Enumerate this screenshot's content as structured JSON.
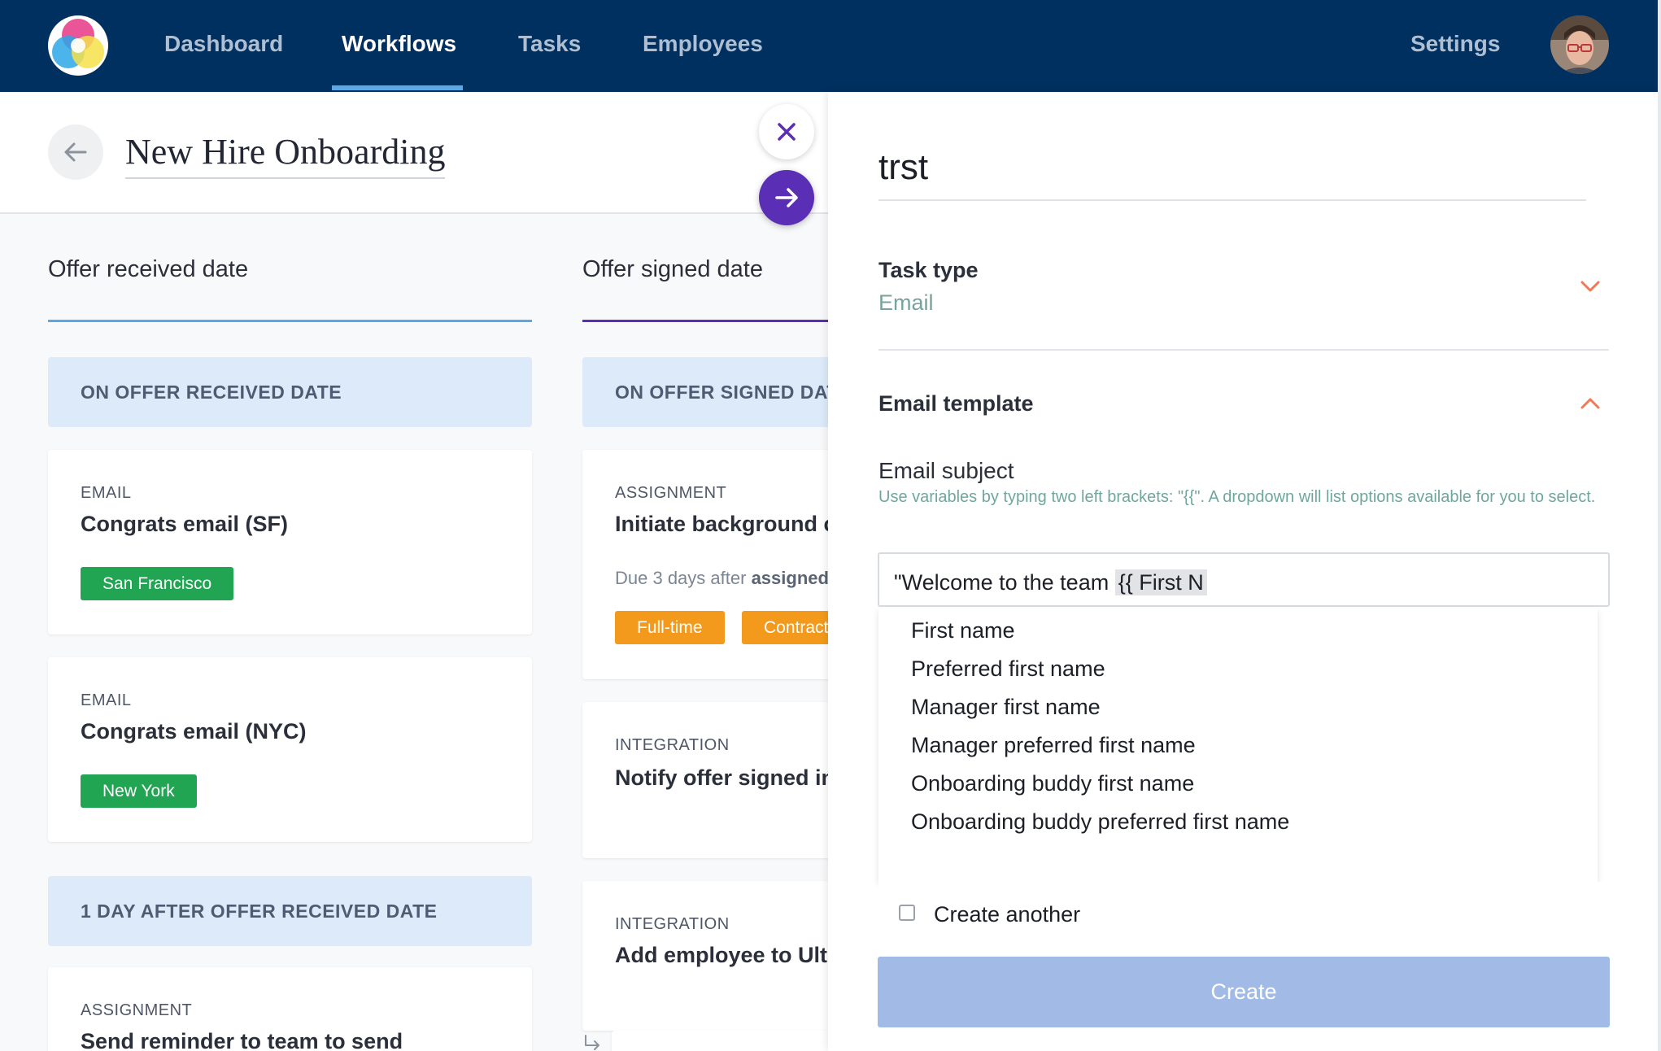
{
  "nav": {
    "items": [
      "Dashboard",
      "Workflows",
      "Tasks",
      "Employees"
    ],
    "active": "Workflows",
    "settings": "Settings"
  },
  "workflow": {
    "title": "New Hire Onboarding"
  },
  "columns": [
    {
      "title": "Offer received date",
      "accent": "#5aa8e6",
      "sections": [
        "ON OFFER RECEIVED DATE",
        "1 DAY AFTER OFFER RECEIVED DATE"
      ],
      "cards": [
        {
          "type": "EMAIL",
          "title": "Congrats email (SF)",
          "tags": [
            "San Francisco"
          ]
        },
        {
          "type": "EMAIL",
          "title": "Congrats email (NYC)",
          "tags": [
            "New York"
          ]
        },
        {
          "type": "ASSIGNMENT",
          "title": "Send reminder to team to send"
        }
      ]
    },
    {
      "title": "Offer signed date",
      "accent": "#5a2fb5",
      "sections": [
        "ON OFFER SIGNED DATE"
      ],
      "cards": [
        {
          "type": "ASSIGNMENT",
          "title": "Initiate background check",
          "due_prefix": "Due 3 days after",
          "due_bold": "assigned",
          "tags": [
            "Full-time",
            "Contract"
          ]
        },
        {
          "type": "INTEGRATION",
          "title": "Notify offer signed in channel"
        },
        {
          "type": "INTEGRATION",
          "title": "Add employee to Ultipro"
        }
      ]
    }
  ],
  "panel": {
    "task_name": "trst",
    "task_type_label": "Task type",
    "task_type_value": "Email",
    "email_template_label": "Email template",
    "email_subject_label": "Email subject",
    "email_subject_hint": "Use variables by typing two left brackets: \"{{\". A dropdown will list options available for you to select.",
    "subject_text": "\"Welcome to the team ",
    "subject_variable": "{{ First N",
    "dropdown_options": [
      "First name",
      "Preferred first name",
      "Manager first name",
      "Manager preferred first name",
      "Onboarding buddy first name",
      "Onboarding buddy preferred first name"
    ],
    "create_another_label": "Create another",
    "create_button": "Create"
  },
  "colors": {
    "nav_bg": "#00305f",
    "accent_purple": "#5a2fb5",
    "tag_green": "#22a553",
    "tag_orange": "#f39a1d",
    "chevron": "#f07a55",
    "create_button": "#a1bbe6"
  }
}
